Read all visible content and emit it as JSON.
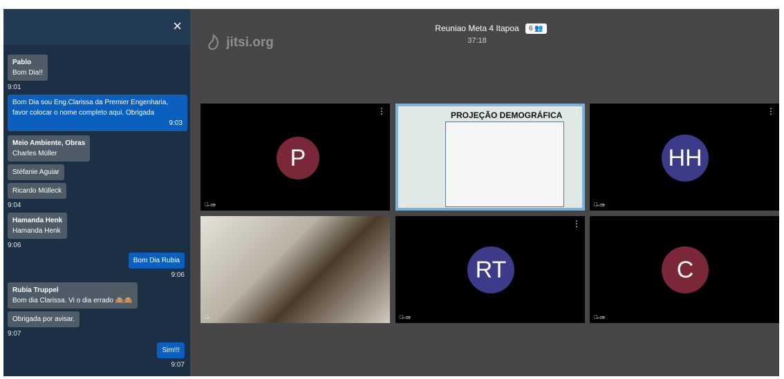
{
  "meeting": {
    "logo": "jitsi.org",
    "title": "Reuniao Meta 4 Itapoa",
    "participants_count": "6",
    "timer": "37:18"
  },
  "chat": {
    "close_icon": "×",
    "messages": [
      {
        "sender": "Pablo",
        "lines": [
          "Bom Dia!!"
        ],
        "time": "9:01",
        "local": false
      },
      {
        "sender": "",
        "lines": [
          "Bom Dia sou Eng.Clarissa da Premier Engenharia,",
          "favor colocar o nome completo aqui. Obrigada"
        ],
        "time": "9:03",
        "local": true
      },
      {
        "sender": "Meio Ambiente, Obras",
        "lines": [
          "Charles Müller"
        ],
        "time": "",
        "local": false
      },
      {
        "sender": "",
        "lines": [
          "Stéfanie Aguiar"
        ],
        "time": "",
        "local": false
      },
      {
        "sender": "",
        "lines": [
          "Ricardo Mülleck"
        ],
        "time": "9:04",
        "local": false
      },
      {
        "sender": "Hamanda Henk",
        "lines": [
          "Hamanda Henk"
        ],
        "time": "9:06",
        "local": false
      },
      {
        "sender": "",
        "lines": [
          "Bom Dia Rubia"
        ],
        "time": "9:06",
        "local": true
      },
      {
        "sender": "Rubia Truppel",
        "lines": [
          "Bom dia Clarissa. Vi o dia errado 🙈🙈"
        ],
        "time": "",
        "local": false
      },
      {
        "sender": "",
        "lines": [
          "Obrigada por avisar."
        ],
        "time": "9:07",
        "local": false
      },
      {
        "sender": "",
        "lines": [
          "Sim!!!"
        ],
        "time": "9:07",
        "local": true
      }
    ]
  },
  "tiles": [
    {
      "name": "P",
      "color": "#7a2838"
    },
    {
      "name": "slide",
      "title": "PROJEÇÃO DEMOGRÁFICA"
    },
    {
      "name": "HH",
      "color": "#3b3b8a"
    },
    {
      "name": "video"
    },
    {
      "name": "RT",
      "color": "#3b3b8a"
    },
    {
      "name": "C",
      "color": "#7a2838"
    }
  ],
  "icons": {
    "muted": "mic-off-icon camera-off-icon",
    "menu": "more-vertical-icon",
    "participants": "participants-icon"
  }
}
